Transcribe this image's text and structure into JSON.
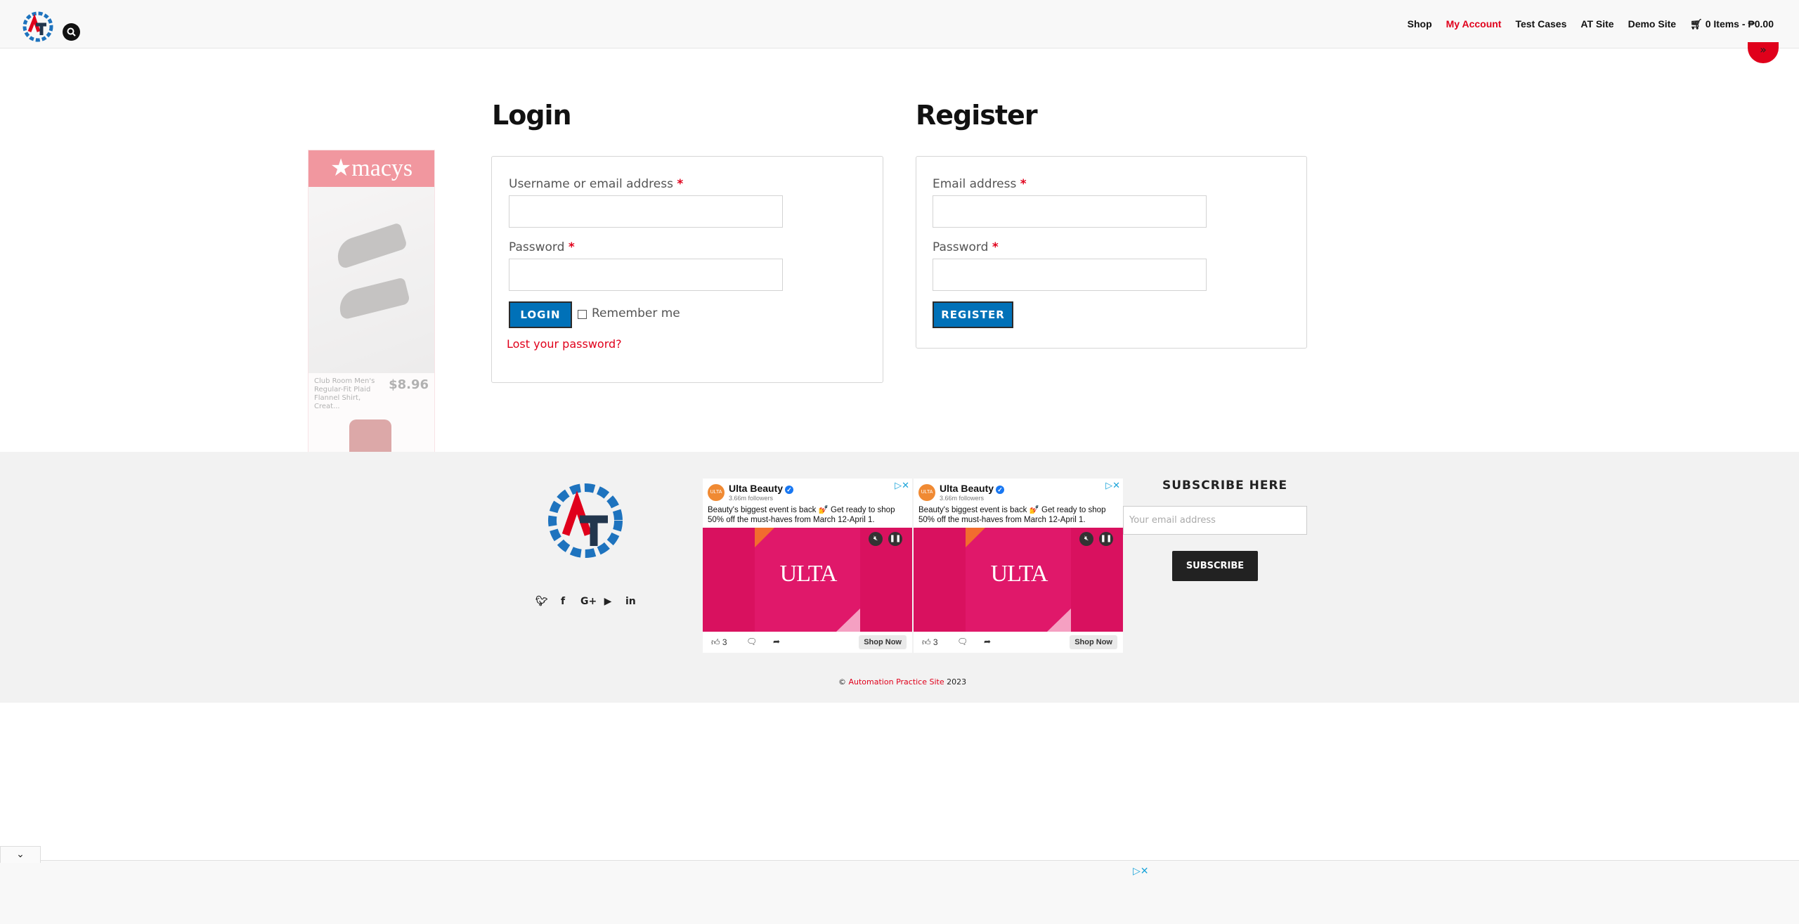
{
  "header": {
    "nav": [
      {
        "label": "Shop",
        "active": false
      },
      {
        "label": "My Account",
        "active": true
      },
      {
        "label": "Test Cases",
        "active": false
      },
      {
        "label": "AT Site",
        "active": false
      },
      {
        "label": "Demo Site",
        "active": false
      }
    ],
    "cart": "0 Items - ₱0.00",
    "search_icon": "search-icon",
    "cart_icon": "cart-icon"
  },
  "login": {
    "title": "Login",
    "username_label": "Username or email address",
    "password_label": "Password",
    "required_mark": "*",
    "button": "LOGIN",
    "remember": "Remember me",
    "lost_password": "Lost your password?"
  },
  "register": {
    "title": "Register",
    "email_label": "Email address",
    "password_label": "Password",
    "required_mark": "*",
    "button": "REGISTER"
  },
  "side_ad": {
    "brand": "★macys",
    "product": "Club Room Men's Regular-Fit Plaid Flannel Shirt, Creat...",
    "price": "$8.96"
  },
  "footer": {
    "social": [
      "twitter-icon",
      "facebook-icon",
      "google-plus-icon",
      "youtube-icon",
      "linkedin-icon"
    ],
    "subscribe_title": "SUBSCRIBE HERE",
    "email_placeholder": "Your email address",
    "subscribe_button": "SUBSCRIBE",
    "copyright_prefix": "©",
    "copyright_link": "Automation Practice Site",
    "copyright_year": "2023"
  },
  "fb_ads": [
    {
      "name": "Ulta Beauty",
      "followers": "3.66m followers",
      "text": "Beauty's biggest event is back 💅 Get ready to shop 50% off the must-haves from March 12-April 1.",
      "brand": "ULTA",
      "likes": "3",
      "cta": "Shop Now",
      "avatar_text": "ULTA"
    },
    {
      "name": "Ulta Beauty",
      "followers": "3.66m followers",
      "text": "Beauty's biggest event is back 💅 Get ready to shop 50% off the must-haves from March 12-April 1.",
      "brand": "ULTA",
      "likes": "3",
      "cta": "Shop Now",
      "avatar_text": "ULTA"
    }
  ],
  "colors": {
    "accent_red": "#e0001b",
    "button_blue": "#0071b8",
    "footer_bg": "#f2f2f2"
  }
}
